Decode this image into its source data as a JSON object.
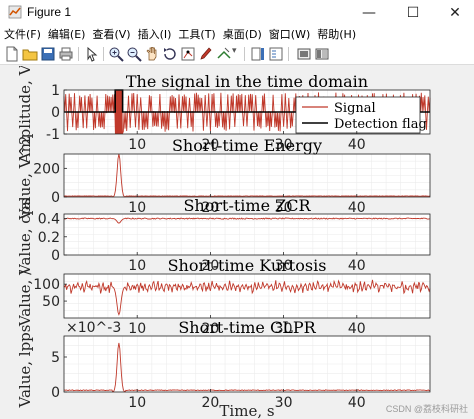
{
  "window": {
    "title": "Figure 1",
    "controls": {
      "minimize": "—",
      "maximize": "☐",
      "close": "✕"
    }
  },
  "menubar": {
    "items": [
      "文件(F)",
      "编辑(E)",
      "查看(V)",
      "插入(I)",
      "工具(T)",
      "桌面(D)",
      "窗口(W)",
      "帮助(H)"
    ]
  },
  "toolbar": {
    "buttons": [
      "new-figure",
      "open-file",
      "save",
      "print",
      "pointer",
      "zoom-in",
      "zoom-out",
      "pan",
      "rotate-3d",
      "data-cursor",
      "brush",
      "link-plot",
      "insert-colorbar",
      "insert-legend",
      "hide-plot-tools",
      "show-plot-tools"
    ]
  },
  "colors": {
    "signal": "#c0392b",
    "detection": "#000000",
    "accent": "#d62728"
  },
  "figure": {
    "xlabel": "Time, s",
    "watermark": "CSDN @荔枝科研社",
    "legend": [
      "Signal",
      "Detection flag"
    ]
  },
  "chart_data": [
    {
      "type": "line",
      "title": "The signal in the time domain",
      "ylabel": "Amplitude, V",
      "xlim": [
        0,
        50
      ],
      "ylim": [
        -1,
        1
      ],
      "xticks": [
        10,
        20,
        30,
        40
      ],
      "yticks": [
        -1,
        0,
        1
      ],
      "legend_position": "top-right",
      "series": [
        {
          "name": "Signal",
          "description_values": {
            "burst_start": 7,
            "burst_end": 8,
            "burst_amplitude": 1.0,
            "pulse_amplitude": 0.9
          }
        },
        {
          "name": "Detection flag",
          "x": [
            0,
            7,
            7,
            8,
            8,
            50
          ],
          "y": [
            0,
            0,
            1,
            1,
            0,
            0
          ]
        }
      ]
    },
    {
      "type": "line",
      "title": "Short-time Energy",
      "ylabel": "Value, V^2",
      "xlim": [
        0,
        50
      ],
      "ylim": [
        0,
        300
      ],
      "xticks": [
        10,
        20,
        30,
        40
      ],
      "yticks": [
        0,
        200
      ],
      "series": [
        {
          "peak_x": 7.5,
          "peak_y": 300,
          "baseline": 5
        }
      ]
    },
    {
      "type": "line",
      "title": "Short-time ZCR",
      "ylabel": "Value, cps",
      "xlim": [
        0,
        50
      ],
      "ylim": [
        0,
        0.45
      ],
      "xticks": [
        10,
        20,
        30,
        40
      ],
      "yticks": [
        0,
        0.2,
        0.4
      ],
      "series": [
        {
          "baseline": 0.4,
          "dip_x": 7.5,
          "dip_y": 0.35
        }
      ]
    },
    {
      "type": "line",
      "title": "Short-time Kurtosis",
      "ylabel": "Value, /",
      "xlim": [
        0,
        50
      ],
      "ylim": [
        0,
        130
      ],
      "xticks": [
        10,
        20,
        30,
        40
      ],
      "yticks": [
        50,
        100
      ],
      "series": [
        {
          "mean": 92,
          "dip_x": 7.5,
          "dip_y": 10
        }
      ]
    },
    {
      "type": "line",
      "title": "Short-time CLPR",
      "ylabel": "Value, lpps",
      "multiplier": "×10^-3",
      "xlim": [
        0,
        50
      ],
      "ylim": [
        0,
        8
      ],
      "xticks": [
        10,
        20,
        30,
        40
      ],
      "yticks": [
        0,
        5
      ],
      "series": [
        {
          "peak_x": 7.5,
          "peak_y": 7,
          "baseline": 0.2
        }
      ]
    }
  ]
}
